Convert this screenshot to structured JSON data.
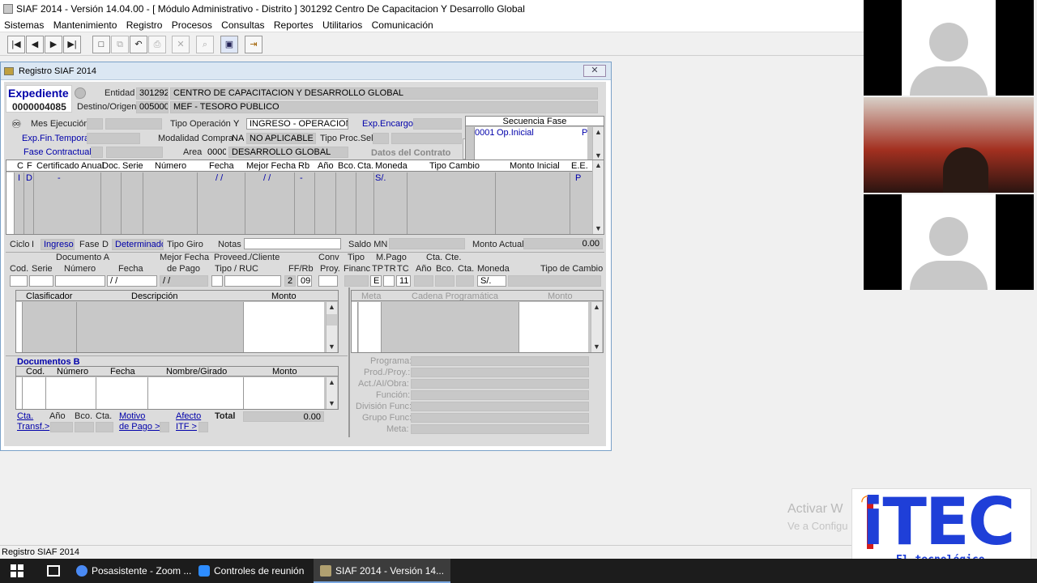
{
  "window": {
    "title": "SIAF 2014 - Versión 14.04.00 - [ Módulo Administrativo - Distrito ] 301292 Centro De Capacitacion Y Desarrollo Global"
  },
  "menu": [
    "Sistemas",
    "Mantenimiento",
    "Registro",
    "Procesos",
    "Consultas",
    "Reportes",
    "Utilitarios",
    "Comunicación"
  ],
  "toolbar": {
    "buttons": [
      {
        "icon": "first-record-icon",
        "glyph": "|◀"
      },
      {
        "icon": "prev-record-icon",
        "glyph": "◀"
      },
      {
        "icon": "next-record-icon",
        "glyph": "▶"
      },
      {
        "icon": "last-record-icon",
        "glyph": "▶|"
      },
      {
        "icon": "new-icon",
        "glyph": "□"
      },
      {
        "icon": "copy-icon",
        "glyph": "⧉"
      },
      {
        "icon": "undo-icon",
        "glyph": "↶"
      },
      {
        "icon": "print-icon",
        "glyph": "⎙"
      },
      {
        "icon": "delete-icon",
        "glyph": "✕"
      },
      {
        "icon": "find-icon",
        "glyph": "⌕"
      },
      {
        "icon": "save-icon",
        "glyph": "▣"
      },
      {
        "icon": "exit-icon",
        "glyph": "⇥"
      }
    ]
  },
  "dialog": {
    "title": "Registro SIAF 2014",
    "close": "✕",
    "expediente_label": "Expediente",
    "expediente_number": "0000004085",
    "entidad_label": "Entidad",
    "entidad_code": "301292",
    "entidad_name": "CENTRO DE CAPACITACION Y DESARROLLO GLOBAL",
    "destino_label": "Destino/Origen",
    "destino_code": "005000",
    "destino_name": "MEF - TESORO PÚBLICO",
    "mes_ejecucion_label": "Mes Ejecución",
    "tipo_operacion_label": "Tipo Operación",
    "tipo_operacion_code": "Y",
    "tipo_operacion_value": "INGRESO - OPERACIONES",
    "exp_encargo_label": "Exp.Encargo",
    "exp_fin_temporal_label": "Exp.Fin.Temporal",
    "modalidad_compra_label": "Modalidad Compra",
    "modalidad_code": "NA",
    "modalidad_value": "NO APLICABLE",
    "tipo_proc_sel_label": "Tipo Proc.Sel.",
    "fase_contractual_label": "Fase Contractual",
    "area_label": "Area",
    "area_code": "0000",
    "area_value": "DESARROLLO GLOBAL",
    "datos_contrato_label": "Datos del Contrato",
    "secuencia_fase": {
      "header": "Secuencia Fase",
      "row_code": "0001",
      "row_name": "Op.Inicial",
      "row_flag": "P"
    },
    "main_grid": {
      "headers": [
        "C",
        "F",
        "Certificado Anual",
        "Doc.",
        "Serie",
        "Número",
        "Fecha",
        "Mejor Fecha",
        "Rb",
        "Año",
        "Bco.",
        "Cta.",
        "Moneda",
        "Tipo Cambio",
        "Monto Inicial",
        "E.E."
      ],
      "row": {
        "c": "I",
        "f": "D",
        "cert": "-",
        "fecha": "/ /",
        "mejor_fecha": "/ /",
        "rb": "-",
        "moneda": "S/.",
        "ee": "P"
      }
    },
    "ciclo_label": "Ciclo",
    "ciclo_code": "I",
    "ciclo_value": "Ingreso",
    "fase_label": "Fase",
    "fase_code": "D",
    "fase_value": "Determinado",
    "tipo_giro_label": "Tipo Giro",
    "notas_label": "Notas",
    "saldo_mn_label": "Saldo MN",
    "monto_actual_label": "Monto Actual",
    "monto_actual_value": "0.00",
    "doc_a": {
      "title": "Documento A",
      "cod": "Cod.",
      "serie": "Serie",
      "numero": "Número",
      "fecha": "Fecha",
      "fecha_value": "/ /",
      "mejor_fecha": "Mejor Fecha",
      "de_pago": "de Pago",
      "mejor_fecha_value": "/ /",
      "proveed": "Proveed./Cliente",
      "tipo_ruc": "Tipo / RUC",
      "ffrb": "FF/Rb",
      "ff_value": "2",
      "rb_value": "09",
      "conv": "Conv",
      "proy": "Proy.",
      "tipo": "Tipo",
      "financ": "Financ",
      "mpago": "M.Pago",
      "tp": "TP",
      "tr": "TR",
      "tc": "TC",
      "tp_value": "E",
      "tc_value": "11",
      "cta_cte": "Cta. Cte.",
      "anio": "Año",
      "bco": "Bco.",
      "cta": "Cta.",
      "moneda": "Moneda",
      "moneda_value": "S/.",
      "tipo_cambio": "Tipo de Cambio"
    },
    "clasificador_grid": {
      "clasificador": "Clasificador",
      "descripcion": "Descripción",
      "monto": "Monto"
    },
    "meta_grid": {
      "meta": "Meta",
      "cadena": "Cadena Programática",
      "monto": "Monto"
    },
    "doc_b": {
      "title": "Documentos B",
      "cod": "Cod.",
      "numero": "Número",
      "fecha": "Fecha",
      "nombre": "Nombre/Girado",
      "monto": "Monto"
    },
    "footer": {
      "cta_transf_1": "Cta.",
      "cta_transf_2": "Transf.>",
      "anio": "Año",
      "bco": "Bco.",
      "cta": "Cta.",
      "motivo_1": "Motivo",
      "motivo_2": "de Pago >",
      "afecto_1": "Afecto",
      "afecto_2": "ITF >",
      "total_label": "Total",
      "total_value": "0.00"
    },
    "prog_labels": [
      "Programa:",
      "Prod./Proy.:",
      "Act./AI/Obra:",
      "Función:",
      "División Func:",
      "Grupo Func:",
      "Meta:"
    ]
  },
  "status_text": "Registro SIAF 2014",
  "watermark": {
    "line1": "Activar W",
    "line2": "Ve a Configu"
  },
  "taskbar": {
    "items": [
      {
        "label": "Posasistente - Zoom ...",
        "color": "#4a8af4"
      },
      {
        "label": "Controles de reunión",
        "color": "#2d8cff"
      },
      {
        "label": "SIAF 2014 - Versión 14...",
        "color": "#b0a070"
      }
    ]
  },
  "logo": {
    "text": "iTEC",
    "tagline": "El tecnológico"
  }
}
